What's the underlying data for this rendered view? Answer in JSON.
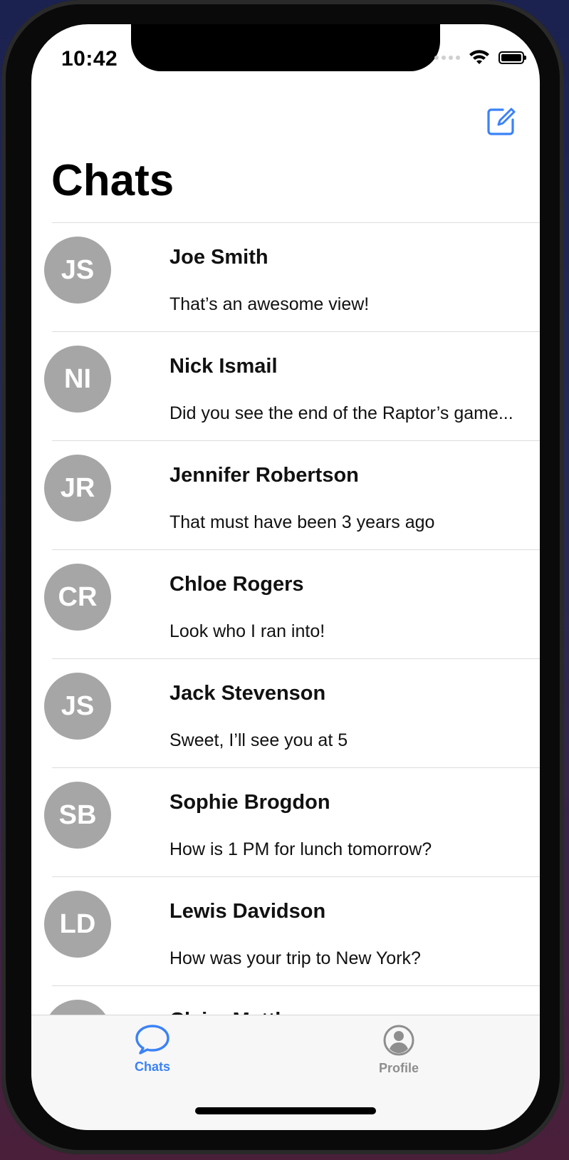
{
  "status_bar": {
    "time": "10:42"
  },
  "header": {
    "title": "Chats",
    "compose_icon": "compose-icon"
  },
  "chats": [
    {
      "initials": "JS",
      "name": "Joe Smith",
      "message": "That’s an awesome view!"
    },
    {
      "initials": "NI",
      "name": "Nick Ismail",
      "message": "Did you see the end of the Raptor’s game..."
    },
    {
      "initials": "JR",
      "name": "Jennifer Robertson",
      "message": "That must have been 3 years ago"
    },
    {
      "initials": "CR",
      "name": "Chloe Rogers",
      "message": "Look who I ran into!"
    },
    {
      "initials": "JS",
      "name": "Jack Stevenson",
      "message": "Sweet, I’ll see you at 5"
    },
    {
      "initials": "SB",
      "name": "Sophie Brogdon",
      "message": "How is 1 PM for lunch tomorrow?"
    },
    {
      "initials": "LD",
      "name": "Lewis Davidson",
      "message": "How was your trip to New York?"
    },
    {
      "initials": "",
      "name": "Claire Matthews",
      "message": ""
    }
  ],
  "tabbar": {
    "tabs": [
      {
        "label": "Chats",
        "icon": "chat-bubble-icon",
        "selected": true
      },
      {
        "label": "Profile",
        "icon": "person-circle-icon",
        "selected": false
      }
    ]
  },
  "colors": {
    "accent": "#3a82f7",
    "avatar_bg": "#a6a6a6",
    "inactive_tab": "#8e8e8e"
  }
}
